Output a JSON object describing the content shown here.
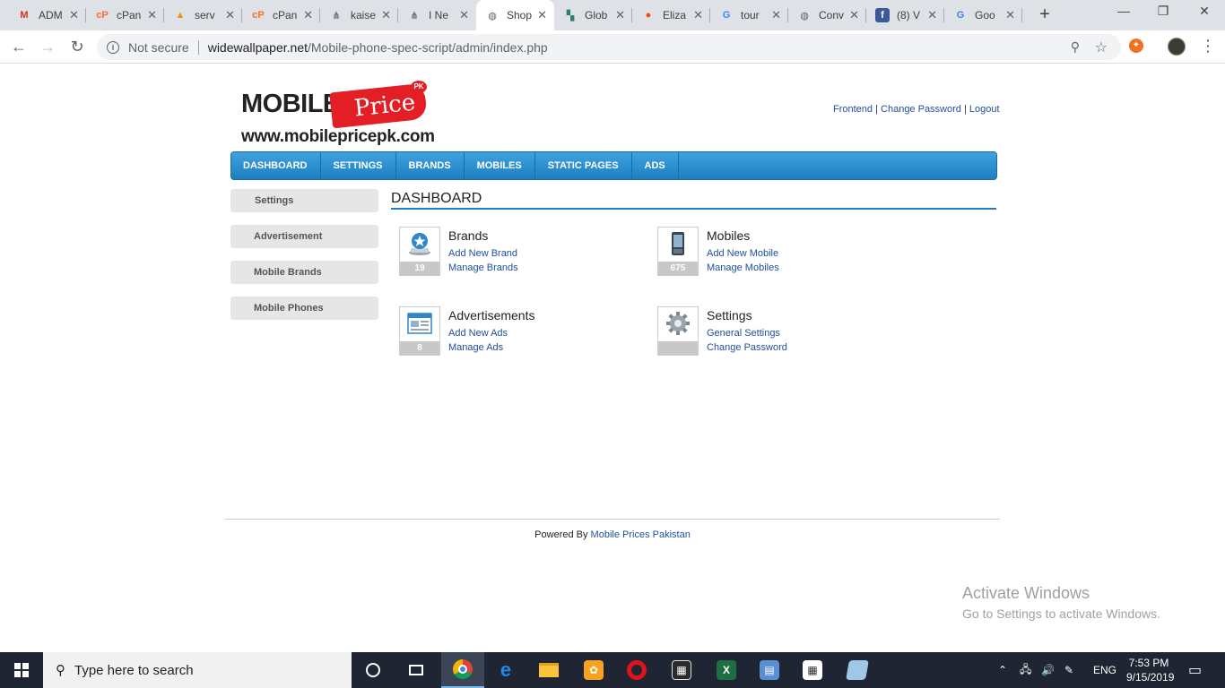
{
  "browser": {
    "tabs": [
      {
        "title": "ADM",
        "icon": "gmail-icon",
        "glyph": "M",
        "color": "#d93025",
        "bg": "transparent"
      },
      {
        "title": "cPan",
        "icon": "cpanel-icon",
        "glyph": "cP",
        "color": "#ff6c2c",
        "bg": "transparent"
      },
      {
        "title": "serv",
        "icon": "phpmyadmin-icon",
        "glyph": "▲",
        "color": "#f29111",
        "bg": "transparent"
      },
      {
        "title": "cPan",
        "icon": "cpanel-icon",
        "glyph": "cP",
        "color": "#ff6c2c",
        "bg": "transparent"
      },
      {
        "title": "kaise",
        "icon": "share-icon",
        "glyph": "⋔",
        "color": "#5f6368",
        "bg": "transparent"
      },
      {
        "title": "I Ne",
        "icon": "share-icon",
        "glyph": "⋔",
        "color": "#5f6368",
        "bg": "transparent"
      },
      {
        "title": "Shop",
        "icon": "globe-icon",
        "glyph": "◍",
        "color": "#5f6368",
        "bg": "transparent"
      },
      {
        "title": "Glob",
        "icon": "map-icon",
        "glyph": "▚",
        "color": "#2e7d6b",
        "bg": "transparent"
      },
      {
        "title": "Eliza",
        "icon": "reddit-icon",
        "glyph": "●",
        "color": "#ff4500",
        "bg": "transparent"
      },
      {
        "title": "tour",
        "icon": "google-icon",
        "glyph": "G",
        "color": "#4285f4",
        "bg": "transparent"
      },
      {
        "title": "Conv",
        "icon": "globe-icon",
        "glyph": "◍",
        "color": "#5f6368",
        "bg": "transparent"
      },
      {
        "title": "(8) V",
        "icon": "facebook-icon",
        "glyph": "f",
        "color": "#ffffff",
        "bg": "#3b5998"
      },
      {
        "title": "Goo",
        "icon": "google-icon",
        "glyph": "G",
        "color": "#4285f4",
        "bg": "transparent"
      }
    ],
    "active_tab": 6,
    "new_tab": "+",
    "window_controls": {
      "minimize": "—",
      "maximize": "❐",
      "close": "✕"
    },
    "nav": {
      "back": "←",
      "forward": "→",
      "reload": "↻"
    },
    "address": {
      "security_label": "Not secure",
      "host": "widewallpaper.net",
      "path": "/Mobile-phone-spec-script/admin/index.php"
    }
  },
  "site": {
    "logo_word": "MOBILE",
    "logo_tag": "Price",
    "logo_badge": "PK",
    "logo_url": "www.mobilepricepk.com"
  },
  "top_links": {
    "frontend": "Frontend",
    "sep": "|",
    "change_password": "Change Password",
    "logout": "Logout"
  },
  "main_nav": [
    "DASHBOARD",
    "SETTINGS",
    "BRANDS",
    "MOBILES",
    "STATIC PAGES",
    "ADS"
  ],
  "sidebar": [
    "Settings",
    "Advertisement",
    "Mobile Brands",
    "Mobile Phones"
  ],
  "dashboard": {
    "heading": "DASHBOARD",
    "cards": [
      {
        "title": "Brands",
        "count": "19",
        "links": [
          "Add New Brand",
          "Manage Brands"
        ],
        "icon": "brand-star-icon"
      },
      {
        "title": "Mobiles",
        "count": "675",
        "links": [
          "Add New Mobile",
          "Manage Mobiles"
        ],
        "icon": "mobile-phone-icon"
      },
      {
        "title": "Advertisements",
        "count": "8",
        "links": [
          "Add New Ads",
          "Manage Ads"
        ],
        "icon": "ads-window-icon"
      },
      {
        "title": "Settings",
        "count": "",
        "links": [
          "General Settings",
          "Change Password"
        ],
        "icon": "settings-gear-icon"
      }
    ]
  },
  "footer": {
    "prefix": "Powered By",
    "link": "Mobile Prices Pakistan"
  },
  "watermark": {
    "line1": "Activate Windows",
    "line2": "Go to Settings to activate Windows."
  },
  "taskbar": {
    "search_placeholder": "Type here to search",
    "tray_lang": "ENG",
    "time": "7:53 PM",
    "date": "9/15/2019"
  },
  "colors": {
    "nav_blue": "#1e7fc0",
    "link_blue": "#1f4e9e",
    "logo_red": "#e31e24"
  }
}
